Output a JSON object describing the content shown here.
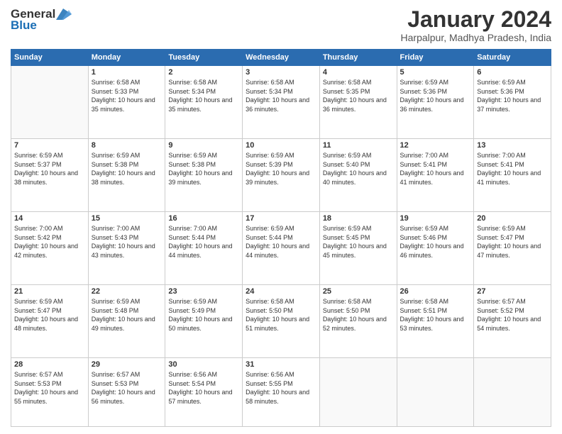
{
  "header": {
    "logo_general": "General",
    "logo_blue": "Blue",
    "month": "January 2024",
    "location": "Harpalpur, Madhya Pradesh, India"
  },
  "days_of_week": [
    "Sunday",
    "Monday",
    "Tuesday",
    "Wednesday",
    "Thursday",
    "Friday",
    "Saturday"
  ],
  "weeks": [
    [
      {
        "day": "",
        "empty": true
      },
      {
        "day": "1",
        "sunrise": "6:58 AM",
        "sunset": "5:33 PM",
        "daylight": "10 hours and 35 minutes."
      },
      {
        "day": "2",
        "sunrise": "6:58 AM",
        "sunset": "5:34 PM",
        "daylight": "10 hours and 35 minutes."
      },
      {
        "day": "3",
        "sunrise": "6:58 AM",
        "sunset": "5:34 PM",
        "daylight": "10 hours and 36 minutes."
      },
      {
        "day": "4",
        "sunrise": "6:58 AM",
        "sunset": "5:35 PM",
        "daylight": "10 hours and 36 minutes."
      },
      {
        "day": "5",
        "sunrise": "6:59 AM",
        "sunset": "5:36 PM",
        "daylight": "10 hours and 36 minutes."
      },
      {
        "day": "6",
        "sunrise": "6:59 AM",
        "sunset": "5:36 PM",
        "daylight": "10 hours and 37 minutes."
      }
    ],
    [
      {
        "day": "7",
        "sunrise": "6:59 AM",
        "sunset": "5:37 PM",
        "daylight": "10 hours and 38 minutes."
      },
      {
        "day": "8",
        "sunrise": "6:59 AM",
        "sunset": "5:38 PM",
        "daylight": "10 hours and 38 minutes."
      },
      {
        "day": "9",
        "sunrise": "6:59 AM",
        "sunset": "5:38 PM",
        "daylight": "10 hours and 39 minutes."
      },
      {
        "day": "10",
        "sunrise": "6:59 AM",
        "sunset": "5:39 PM",
        "daylight": "10 hours and 39 minutes."
      },
      {
        "day": "11",
        "sunrise": "6:59 AM",
        "sunset": "5:40 PM",
        "daylight": "10 hours and 40 minutes."
      },
      {
        "day": "12",
        "sunrise": "7:00 AM",
        "sunset": "5:41 PM",
        "daylight": "10 hours and 41 minutes."
      },
      {
        "day": "13",
        "sunrise": "7:00 AM",
        "sunset": "5:41 PM",
        "daylight": "10 hours and 41 minutes."
      }
    ],
    [
      {
        "day": "14",
        "sunrise": "7:00 AM",
        "sunset": "5:42 PM",
        "daylight": "10 hours and 42 minutes."
      },
      {
        "day": "15",
        "sunrise": "7:00 AM",
        "sunset": "5:43 PM",
        "daylight": "10 hours and 43 minutes."
      },
      {
        "day": "16",
        "sunrise": "7:00 AM",
        "sunset": "5:44 PM",
        "daylight": "10 hours and 44 minutes."
      },
      {
        "day": "17",
        "sunrise": "6:59 AM",
        "sunset": "5:44 PM",
        "daylight": "10 hours and 44 minutes."
      },
      {
        "day": "18",
        "sunrise": "6:59 AM",
        "sunset": "5:45 PM",
        "daylight": "10 hours and 45 minutes."
      },
      {
        "day": "19",
        "sunrise": "6:59 AM",
        "sunset": "5:46 PM",
        "daylight": "10 hours and 46 minutes."
      },
      {
        "day": "20",
        "sunrise": "6:59 AM",
        "sunset": "5:47 PM",
        "daylight": "10 hours and 47 minutes."
      }
    ],
    [
      {
        "day": "21",
        "sunrise": "6:59 AM",
        "sunset": "5:47 PM",
        "daylight": "10 hours and 48 minutes."
      },
      {
        "day": "22",
        "sunrise": "6:59 AM",
        "sunset": "5:48 PM",
        "daylight": "10 hours and 49 minutes."
      },
      {
        "day": "23",
        "sunrise": "6:59 AM",
        "sunset": "5:49 PM",
        "daylight": "10 hours and 50 minutes."
      },
      {
        "day": "24",
        "sunrise": "6:58 AM",
        "sunset": "5:50 PM",
        "daylight": "10 hours and 51 minutes."
      },
      {
        "day": "25",
        "sunrise": "6:58 AM",
        "sunset": "5:50 PM",
        "daylight": "10 hours and 52 minutes."
      },
      {
        "day": "26",
        "sunrise": "6:58 AM",
        "sunset": "5:51 PM",
        "daylight": "10 hours and 53 minutes."
      },
      {
        "day": "27",
        "sunrise": "6:57 AM",
        "sunset": "5:52 PM",
        "daylight": "10 hours and 54 minutes."
      }
    ],
    [
      {
        "day": "28",
        "sunrise": "6:57 AM",
        "sunset": "5:53 PM",
        "daylight": "10 hours and 55 minutes."
      },
      {
        "day": "29",
        "sunrise": "6:57 AM",
        "sunset": "5:53 PM",
        "daylight": "10 hours and 56 minutes."
      },
      {
        "day": "30",
        "sunrise": "6:56 AM",
        "sunset": "5:54 PM",
        "daylight": "10 hours and 57 minutes."
      },
      {
        "day": "31",
        "sunrise": "6:56 AM",
        "sunset": "5:55 PM",
        "daylight": "10 hours and 58 minutes."
      },
      {
        "day": "",
        "empty": true
      },
      {
        "day": "",
        "empty": true
      },
      {
        "day": "",
        "empty": true
      }
    ]
  ]
}
